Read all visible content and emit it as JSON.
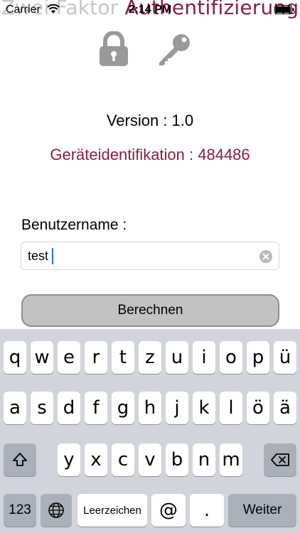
{
  "header": {
    "title_part1": "Zwei Faktor ",
    "title_part2": "Authentifizierung"
  },
  "status_bar": {
    "carrier": "Carrier",
    "time": "2:14 PM",
    "wifi_icon": "wifi-icon",
    "battery_icon": "battery-icon"
  },
  "icons": {
    "lock": "lock-icon",
    "key": "key-icon",
    "clear": "clear-icon",
    "lock_color": "#999999",
    "key_color": "#999999"
  },
  "info": {
    "version": "Version : 1.0",
    "device_id": "Geräteidentifikation : 484486",
    "accent_color": "#8a1d48"
  },
  "form": {
    "username_label": "Benutzername :",
    "username_value": "test",
    "submit_label": "Berechnen"
  },
  "keyboard": {
    "row1": [
      "q",
      "w",
      "e",
      "r",
      "t",
      "z",
      "u",
      "i",
      "o",
      "p",
      "ü"
    ],
    "row2": [
      "a",
      "s",
      "d",
      "f",
      "g",
      "h",
      "j",
      "k",
      "l",
      "ö",
      "ä"
    ],
    "row3": [
      "y",
      "x",
      "c",
      "v",
      "b",
      "n",
      "m"
    ],
    "shift_icon": "shift-icon",
    "backspace_icon": "backspace-icon",
    "globe_icon": "globe-icon",
    "numbers_label": "123",
    "space_label": "Leerzeichen",
    "at_label": "@",
    "dot_label": ".",
    "return_label": "Weiter"
  }
}
